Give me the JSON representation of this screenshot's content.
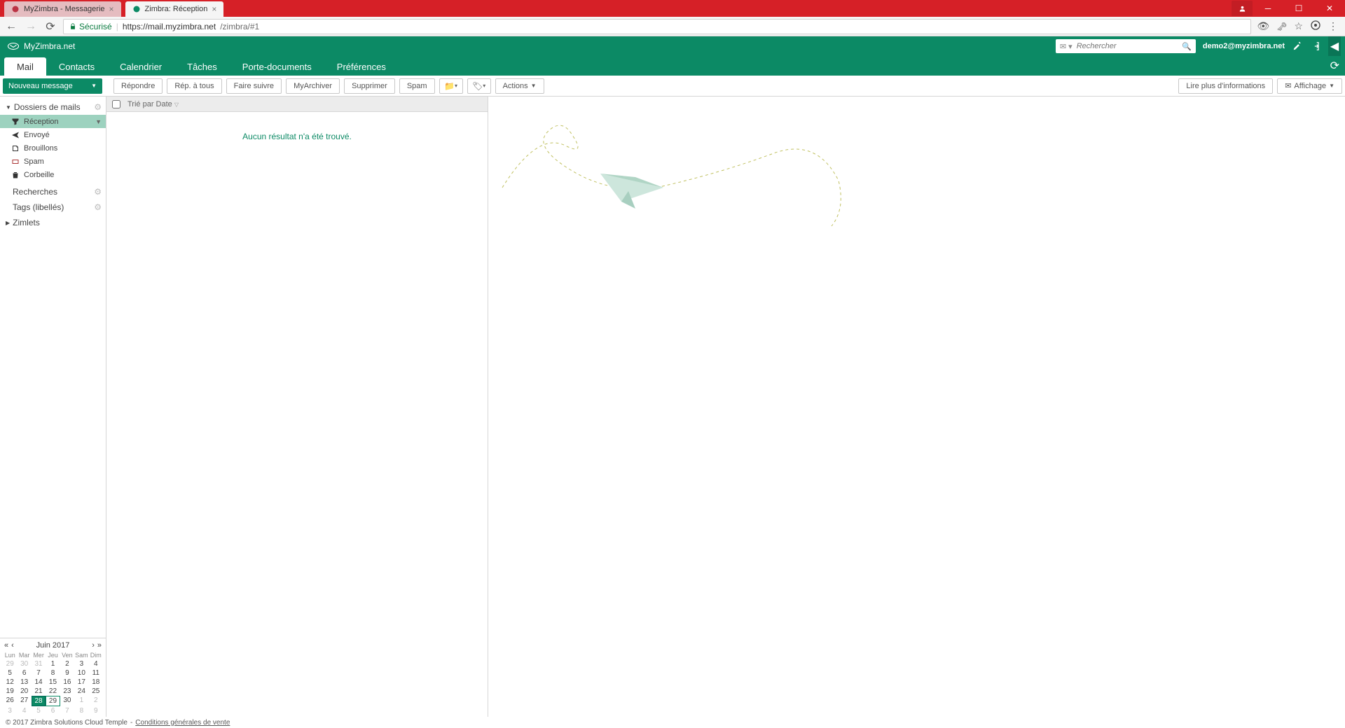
{
  "browser": {
    "tabs": [
      {
        "title": "MyZimbra - Messagerie",
        "active": false
      },
      {
        "title": "Zimbra: Réception",
        "active": true
      }
    ],
    "secure_label": "Sécurisé",
    "url_host": "https://mail.myzimbra.net",
    "url_path": "/zimbra/#1"
  },
  "header": {
    "brand": "MyZimbra.net",
    "search_placeholder": "Rechercher",
    "user_email": "demo2@myzimbra.net"
  },
  "tabs": {
    "items": [
      "Mail",
      "Contacts",
      "Calendrier",
      "Tâches",
      "Porte-documents",
      "Préférences"
    ],
    "active_index": 0
  },
  "toolbar": {
    "new_message": "Nouveau message",
    "reply": "Répondre",
    "reply_all": "Rép. à tous",
    "forward": "Faire suivre",
    "archive": "MyArchiver",
    "delete": "Supprimer",
    "spam": "Spam",
    "actions": "Actions",
    "read_more": "Lire plus d'informations",
    "view": "Affichage"
  },
  "sidebar": {
    "folders_header": "Dossiers de mails",
    "folders": [
      {
        "label": "Réception"
      },
      {
        "label": "Envoyé"
      },
      {
        "label": "Brouillons"
      },
      {
        "label": "Spam"
      },
      {
        "label": "Corbeille"
      }
    ],
    "searches": "Recherches",
    "tags": "Tags (libellés)",
    "zimlets": "Zimlets"
  },
  "msglist": {
    "sort_label": "Trié par Date",
    "empty": "Aucun résultat n'a été trouvé."
  },
  "calendar": {
    "month_label": "Juin 2017",
    "day_heads": [
      "Lun",
      "Mar",
      "Mer",
      "Jeu",
      "Ven",
      "Sam",
      "Dim"
    ],
    "weeks": [
      [
        {
          "d": 29,
          "m": true
        },
        {
          "d": 30,
          "m": true
        },
        {
          "d": 31,
          "m": true
        },
        {
          "d": 1
        },
        {
          "d": 2
        },
        {
          "d": 3
        },
        {
          "d": 4
        }
      ],
      [
        {
          "d": 5
        },
        {
          "d": 6
        },
        {
          "d": 7
        },
        {
          "d": 8
        },
        {
          "d": 9
        },
        {
          "d": 10
        },
        {
          "d": 11
        }
      ],
      [
        {
          "d": 12
        },
        {
          "d": 13
        },
        {
          "d": 14
        },
        {
          "d": 15
        },
        {
          "d": 16
        },
        {
          "d": 17
        },
        {
          "d": 18
        }
      ],
      [
        {
          "d": 19
        },
        {
          "d": 20
        },
        {
          "d": 21
        },
        {
          "d": 22
        },
        {
          "d": 23
        },
        {
          "d": 24
        },
        {
          "d": 25
        }
      ],
      [
        {
          "d": 26
        },
        {
          "d": 27
        },
        {
          "d": 28,
          "today": true
        },
        {
          "d": 29,
          "outlined": true
        },
        {
          "d": 30
        },
        {
          "d": 1,
          "m": true
        },
        {
          "d": 2,
          "m": true
        }
      ],
      [
        {
          "d": 3,
          "m": true
        },
        {
          "d": 4,
          "m": true
        },
        {
          "d": 5,
          "m": true
        },
        {
          "d": 6,
          "m": true
        },
        {
          "d": 7,
          "m": true
        },
        {
          "d": 8,
          "m": true
        },
        {
          "d": 9,
          "m": true
        }
      ]
    ]
  },
  "footer": {
    "copyright": "© 2017 Zimbra Solutions Cloud Temple",
    "sep": " - ",
    "link": "Conditions générales de vente"
  }
}
